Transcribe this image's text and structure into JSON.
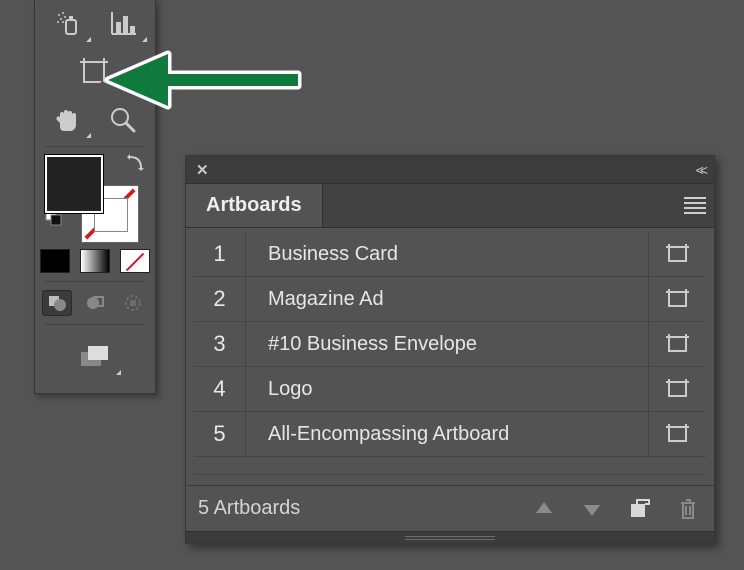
{
  "toolbar": {
    "tools": {
      "symbol_sprayer": "symbol-sprayer-tool",
      "graph": "column-graph-tool",
      "artboard": "artboard-tool",
      "hand": "hand-tool",
      "zoom": "zoom-tool"
    }
  },
  "panel": {
    "tab_label": "Artboards",
    "items": [
      {
        "index": "1",
        "name": "Business Card"
      },
      {
        "index": "2",
        "name": "Magazine Ad"
      },
      {
        "index": "3",
        "name": "#10 Business Envelope"
      },
      {
        "index": "4",
        "name": "Logo"
      },
      {
        "index": "5",
        "name": "All-Encompassing Artboard"
      }
    ],
    "status_text": "5 Artboards"
  }
}
